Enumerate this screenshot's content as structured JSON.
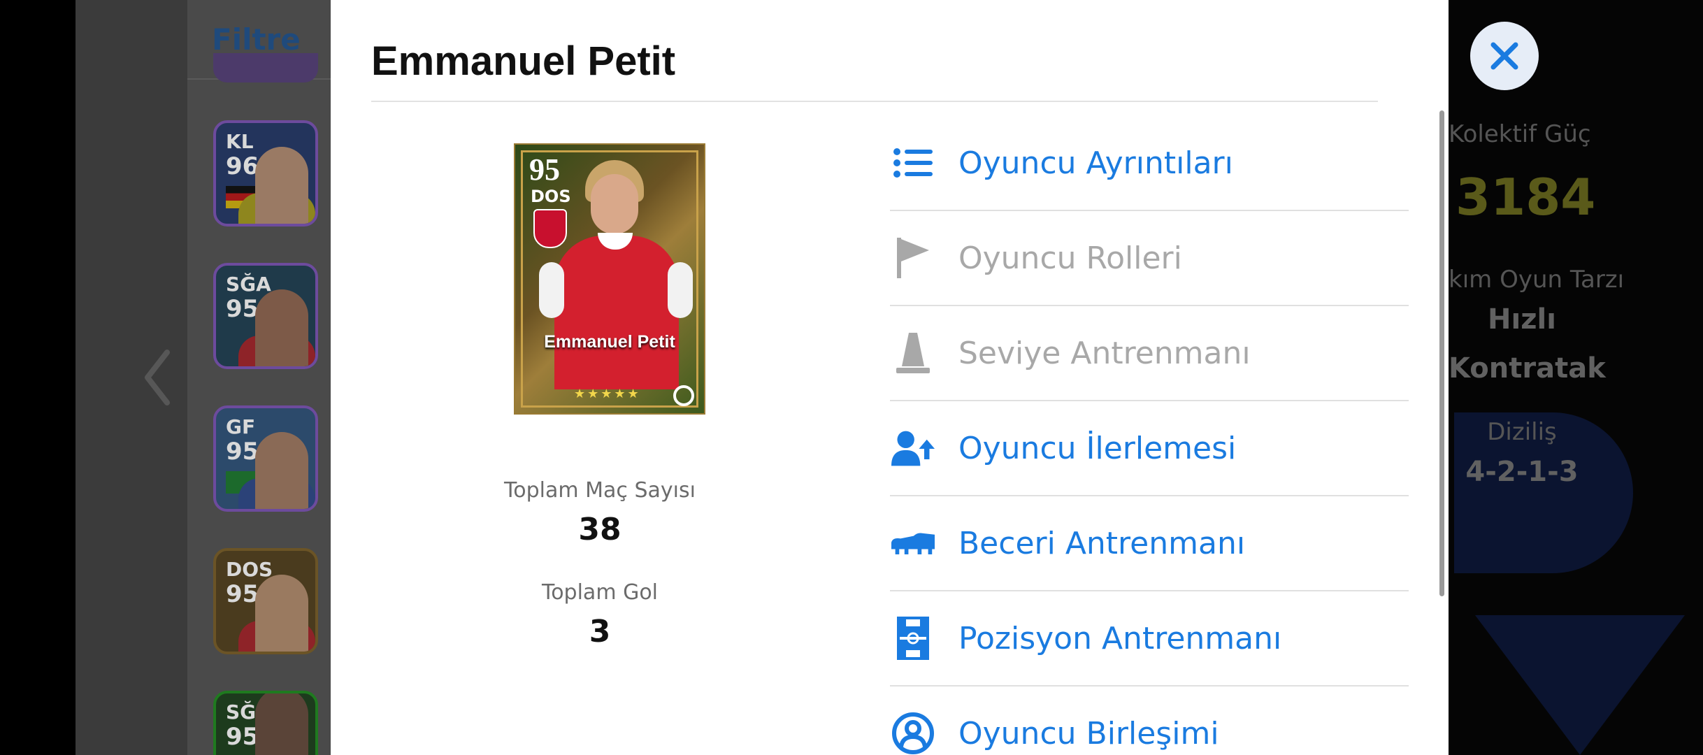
{
  "background": {
    "filter_label": "Filtre",
    "squad_cards": [
      {
        "position": "KL",
        "rating": "96",
        "jersey_color": "#c4b82a"
      },
      {
        "position": "SĞA",
        "rating": "95",
        "jersey_color": "#b7282e"
      },
      {
        "position": "GF",
        "rating": "95",
        "jersey_color": "#274b9b"
      },
      {
        "position": "DOS",
        "rating": "95",
        "jersey_color": "#b7282e"
      },
      {
        "position": "SĞK",
        "rating": "95",
        "jersey_color": "#222222"
      }
    ],
    "team_panel": {
      "collective_power_label": "Kolektif Güç",
      "collective_power_value": "3184",
      "team_playstyle_label": "kım Oyun Tarzı",
      "team_playstyle_value_1": "Hızlı",
      "team_playstyle_value_2": "Kontratak",
      "formation_label": "Diziliş",
      "formation_value": "4-2-1-3"
    }
  },
  "modal": {
    "player_name": "Emmanuel Petit",
    "card": {
      "rating": "95",
      "position": "DOS",
      "name": "Emmanuel Petit",
      "stars": "★★★★★"
    },
    "stats": {
      "matches_label": "Toplam Maç Sayısı",
      "matches_value": "38",
      "goals_label": "Toplam Gol",
      "goals_value": "3"
    },
    "menu": [
      {
        "label": "Oyuncu Ayrıntıları",
        "icon": "list-icon",
        "enabled": true
      },
      {
        "label": "Oyuncu Rolleri",
        "icon": "flag-icon",
        "enabled": false
      },
      {
        "label": "Seviye Antrenmanı",
        "icon": "training-cone-icon",
        "enabled": false
      },
      {
        "label": "Oyuncu İlerlemesi",
        "icon": "user-progress-icon",
        "enabled": true
      },
      {
        "label": "Beceri Antrenmanı",
        "icon": "football-boot-icon",
        "enabled": true
      },
      {
        "label": "Pozisyon Antrenmanı",
        "icon": "pitch-icon",
        "enabled": true
      },
      {
        "label": "Oyuncu Birleşimi",
        "icon": "player-merge-icon",
        "enabled": true
      }
    ]
  },
  "colors": {
    "accent": "#1a7be0",
    "disabled": "#a8a8a8",
    "close_button_bg": "#e6edf7"
  }
}
